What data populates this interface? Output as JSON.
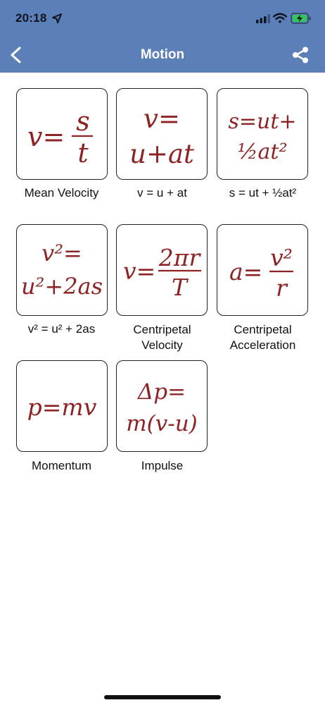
{
  "status_bar": {
    "time": "20:18",
    "icons": [
      "location-arrow-icon",
      "signal-icon",
      "wifi-icon",
      "battery-charging-icon"
    ]
  },
  "nav": {
    "title": "Motion",
    "back_icon": "chevron-left-icon",
    "share_icon": "share-icon"
  },
  "colors": {
    "header": "#5b7fb7",
    "formula": "#8e2323"
  },
  "formulas": [
    {
      "label": "Mean Velocity",
      "f": {
        "lhs": "v=",
        "num": "s",
        "den": "t"
      }
    },
    {
      "label": "v = u + at",
      "f": {
        "l1": "v=",
        "l2": "u+at"
      }
    },
    {
      "label": "s = ut + ½at²",
      "f": {
        "l1": "s=ut+",
        "l2": "½at²"
      }
    },
    {
      "label": "v² = u² + 2as",
      "f": {
        "l1": "v²=",
        "l2": "u²+2as"
      }
    },
    {
      "label_1": "Centripetal",
      "label_2": "Velocity",
      "f": {
        "lhs": "v=",
        "num": "2πr",
        "den": "T"
      }
    },
    {
      "label_1": "Centripetal",
      "label_2": "Acceleration",
      "f": {
        "lhs": "a=",
        "num": "v²",
        "den": "r"
      }
    },
    {
      "label": "Momentum",
      "f": {
        "l1": "p=mv"
      }
    },
    {
      "label": "Impulse",
      "f": {
        "l1": "Δp=",
        "l2": "m(v-u)"
      }
    }
  ]
}
